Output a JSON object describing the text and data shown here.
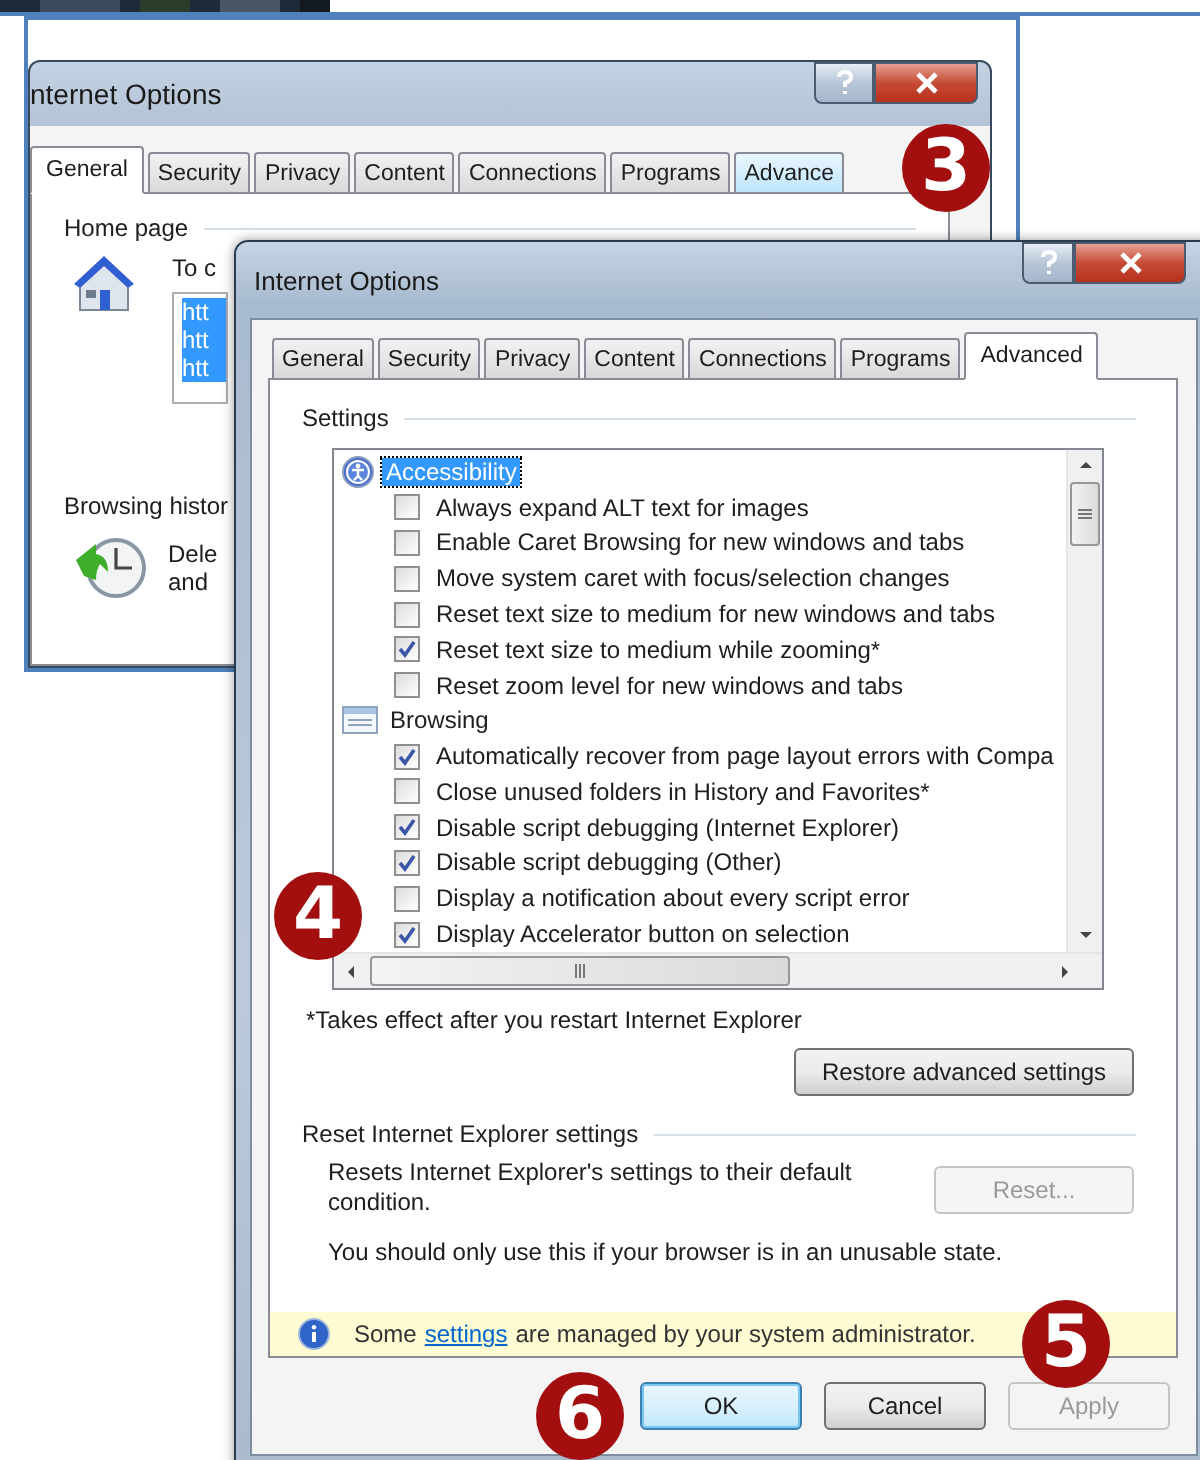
{
  "background_window": {
    "title": "nternet Options",
    "tabs": [
      {
        "label": "General",
        "selected": true
      },
      {
        "label": "Security",
        "selected": false
      },
      {
        "label": "Privacy",
        "selected": false
      },
      {
        "label": "Content",
        "selected": false
      },
      {
        "label": "Connections",
        "selected": false
      },
      {
        "label": "Programs",
        "selected": false
      },
      {
        "label": "Advance",
        "selected": false,
        "hovered": true
      }
    ],
    "home_page": {
      "label": "Home page",
      "instruction": "To c",
      "urls": [
        "htt",
        "htt",
        "htt"
      ]
    },
    "browsing_history": {
      "label": "Browsing histor",
      "lines": [
        "Dele",
        "and"
      ]
    }
  },
  "window": {
    "title": "Internet Options",
    "tabs": [
      {
        "label": "General",
        "selected": false
      },
      {
        "label": "Security",
        "selected": false
      },
      {
        "label": "Privacy",
        "selected": false
      },
      {
        "label": "Content",
        "selected": false
      },
      {
        "label": "Connections",
        "selected": false
      },
      {
        "label": "Programs",
        "selected": false
      },
      {
        "label": "Advanced",
        "selected": true
      }
    ],
    "settings": {
      "label": "Settings",
      "categories": [
        {
          "label": "Accessibility",
          "kind": "accessibility",
          "selected": true,
          "children": [
            {
              "label": "Always expand ALT text for images",
              "checked": false
            },
            {
              "label": "Enable Caret Browsing for new windows and tabs",
              "checked": false
            },
            {
              "label": "Move system caret with focus/selection changes",
              "checked": false
            },
            {
              "label": "Reset text size to medium for new windows and tabs",
              "checked": false
            },
            {
              "label": "Reset text size to medium while zooming*",
              "checked": true
            },
            {
              "label": "Reset zoom level for new windows and tabs",
              "checked": false
            }
          ]
        },
        {
          "label": "Browsing",
          "kind": "browsing",
          "selected": false,
          "children": [
            {
              "label": "Automatically recover from page layout errors with Compa",
              "checked": true
            },
            {
              "label": "Close unused folders in History and Favorites*",
              "checked": false
            },
            {
              "label": "Disable script debugging (Internet Explorer)",
              "checked": true
            },
            {
              "label": "Disable script debugging (Other)",
              "checked": true
            },
            {
              "label": "Display a notification about every script error",
              "checked": false
            },
            {
              "label": "Display Accelerator button on selection",
              "checked": true
            }
          ]
        }
      ]
    },
    "footnote": "*Takes effect after you restart Internet Explorer",
    "restore_button": {
      "label": "Restore advanced settings",
      "disabled": false
    },
    "reset_group": {
      "label": "Reset Internet Explorer settings",
      "description": "Resets Internet Explorer's settings to their default condition.",
      "button": {
        "label": "Reset...",
        "disabled": true
      },
      "note": "You should only use this if your browser is in an unusable state."
    },
    "info_bar": {
      "before": "Some",
      "link": "settings",
      "after": "are managed by your system administrator."
    },
    "buttons": [
      {
        "label": "OK",
        "focused": true,
        "disabled": false
      },
      {
        "label": "Cancel",
        "focused": false,
        "disabled": false
      },
      {
        "label": "Apply",
        "focused": false,
        "disabled": true
      }
    ]
  },
  "callouts": [
    {
      "label": "3"
    },
    {
      "label": "4"
    },
    {
      "label": "5"
    },
    {
      "label": "6"
    }
  ]
}
